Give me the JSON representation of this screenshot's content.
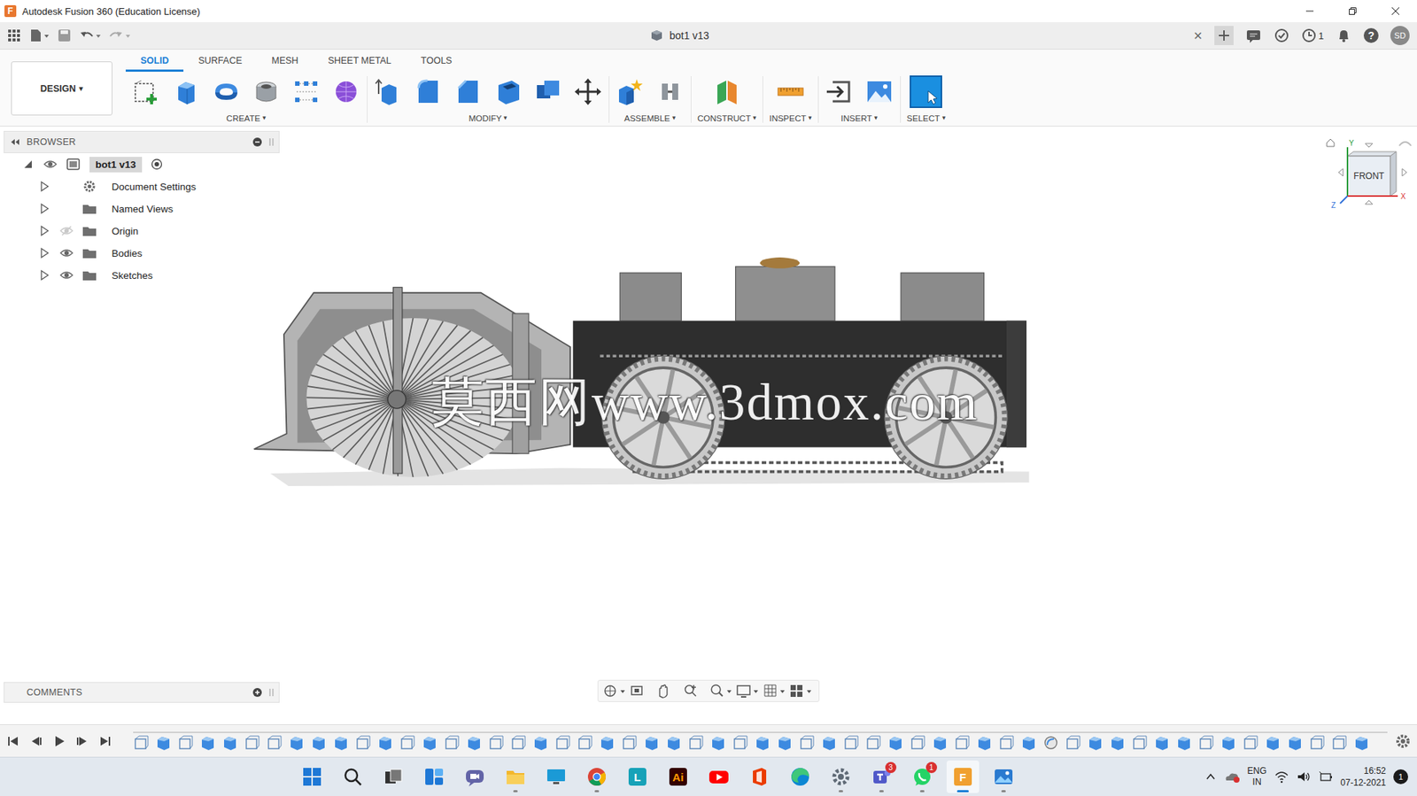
{
  "window": {
    "title": "Autodesk Fusion 360 (Education License)",
    "logo": "F"
  },
  "document": {
    "title": "bot1 v13",
    "close": "×"
  },
  "header": {
    "jobs": "1",
    "user": "SD",
    "help": "?"
  },
  "workspace": {
    "label": "DESIGN",
    "caret": "▾"
  },
  "tabs": [
    {
      "label": "SOLID",
      "selected": true
    },
    {
      "label": "SURFACE",
      "selected": false
    },
    {
      "label": "MESH",
      "selected": false
    },
    {
      "label": "SHEET METAL",
      "selected": false
    },
    {
      "label": "TOOLS",
      "selected": false
    }
  ],
  "tool_groups": [
    {
      "label": "CREATE",
      "caret": "▾"
    },
    {
      "label": "MODIFY",
      "caret": "▾"
    },
    {
      "label": "ASSEMBLE",
      "caret": "▾"
    },
    {
      "label": "CONSTRUCT",
      "caret": "▾"
    },
    {
      "label": "INSPECT",
      "caret": "▾"
    },
    {
      "label": "INSERT",
      "caret": "▾"
    },
    {
      "label": "SELECT",
      "caret": "▾"
    }
  ],
  "browser": {
    "title": "BROWSER",
    "items": [
      {
        "label": "bot1 v13",
        "kind": "root",
        "expanded": true,
        "has_eye": true,
        "visible": true,
        "selected": true
      },
      {
        "label": "Document Settings",
        "kind": "settings",
        "expanded": false,
        "has_eye": false,
        "visible": true,
        "selected": false
      },
      {
        "label": "Named Views",
        "kind": "folder",
        "expanded": false,
        "has_eye": false,
        "visible": true,
        "selected": false
      },
      {
        "label": "Origin",
        "kind": "folder",
        "expanded": false,
        "has_eye": true,
        "visible": false,
        "selected": false
      },
      {
        "label": "Bodies",
        "kind": "folder",
        "expanded": false,
        "has_eye": true,
        "visible": true,
        "selected": false
      },
      {
        "label": "Sketches",
        "kind": "folder",
        "expanded": false,
        "has_eye": true,
        "visible": true,
        "selected": false
      }
    ]
  },
  "viewcube": {
    "face": "FRONT",
    "axis_y": "Y",
    "axis_x": "X",
    "axis_z": "Z"
  },
  "watermark": "莫西网www.3dmox.com",
  "comments": {
    "title": "COMMENTS"
  },
  "timeline": {
    "features": [
      "sketch",
      "extrude",
      "sketch",
      "extrude",
      "extrude",
      "sketch",
      "sketch",
      "extrude",
      "extrude",
      "extrude",
      "sketch",
      "extrude",
      "sketch",
      "extrude",
      "sketch",
      "extrude",
      "sketch",
      "sketch",
      "extrude",
      "sketch",
      "sketch",
      "extrude",
      "sketch",
      "extrude",
      "extrude",
      "sketch",
      "extrude",
      "sketch",
      "extrude",
      "extrude",
      "sketch",
      "extrude",
      "sketch",
      "sketch",
      "extrude",
      "sketch",
      "extrude",
      "sketch",
      "extrude",
      "sketch",
      "extrude",
      "fillet",
      "sketch",
      "extrude",
      "extrude",
      "sketch",
      "extrude",
      "extrude",
      "sketch",
      "extrude",
      "sketch",
      "extrude",
      "extrude",
      "sketch",
      "sketch",
      "extrude"
    ]
  },
  "taskbar": {
    "apps": [
      {
        "kind": "start",
        "label": "",
        "badge": "",
        "running": false,
        "selected": false
      },
      {
        "kind": "search",
        "label": "",
        "badge": "",
        "running": false,
        "selected": false
      },
      {
        "kind": "taskview",
        "label": "",
        "badge": "",
        "running": false,
        "selected": false
      },
      {
        "kind": "widgets",
        "label": "",
        "badge": "",
        "running": false,
        "selected": false
      },
      {
        "kind": "chat",
        "label": "",
        "badge": "",
        "running": false,
        "selected": false
      },
      {
        "kind": "explorer",
        "label": "",
        "badge": "",
        "running": true,
        "selected": false
      },
      {
        "kind": "monitor",
        "label": "",
        "badge": "",
        "running": false,
        "selected": false
      },
      {
        "kind": "chrome",
        "label": "",
        "badge": "",
        "running": true,
        "selected": false
      },
      {
        "kind": "lens",
        "label": "L",
        "badge": "",
        "running": false,
        "selected": false
      },
      {
        "kind": "illustrator",
        "label": "Ai",
        "badge": "",
        "running": false,
        "selected": false
      },
      {
        "kind": "youtube",
        "label": "",
        "badge": "",
        "running": false,
        "selected": false
      },
      {
        "kind": "office",
        "label": "",
        "badge": "",
        "running": false,
        "selected": false
      },
      {
        "kind": "edge",
        "label": "",
        "badge": "",
        "running": false,
        "selected": false
      },
      {
        "kind": "settings",
        "label": "",
        "badge": "",
        "running": true,
        "selected": false
      },
      {
        "kind": "teams",
        "label": "",
        "badge": "3",
        "running": true,
        "selected": false
      },
      {
        "kind": "whatsapp",
        "label": "",
        "badge": "1",
        "running": true,
        "selected": false
      },
      {
        "kind": "fusion",
        "label": "F",
        "badge": "",
        "running": true,
        "selected": true
      },
      {
        "kind": "photos",
        "label": "",
        "badge": "",
        "running": true,
        "selected": false
      }
    ],
    "language": "ENG",
    "region": "IN",
    "time": "16:52",
    "date": "07-12-2021",
    "notifications": "1"
  }
}
